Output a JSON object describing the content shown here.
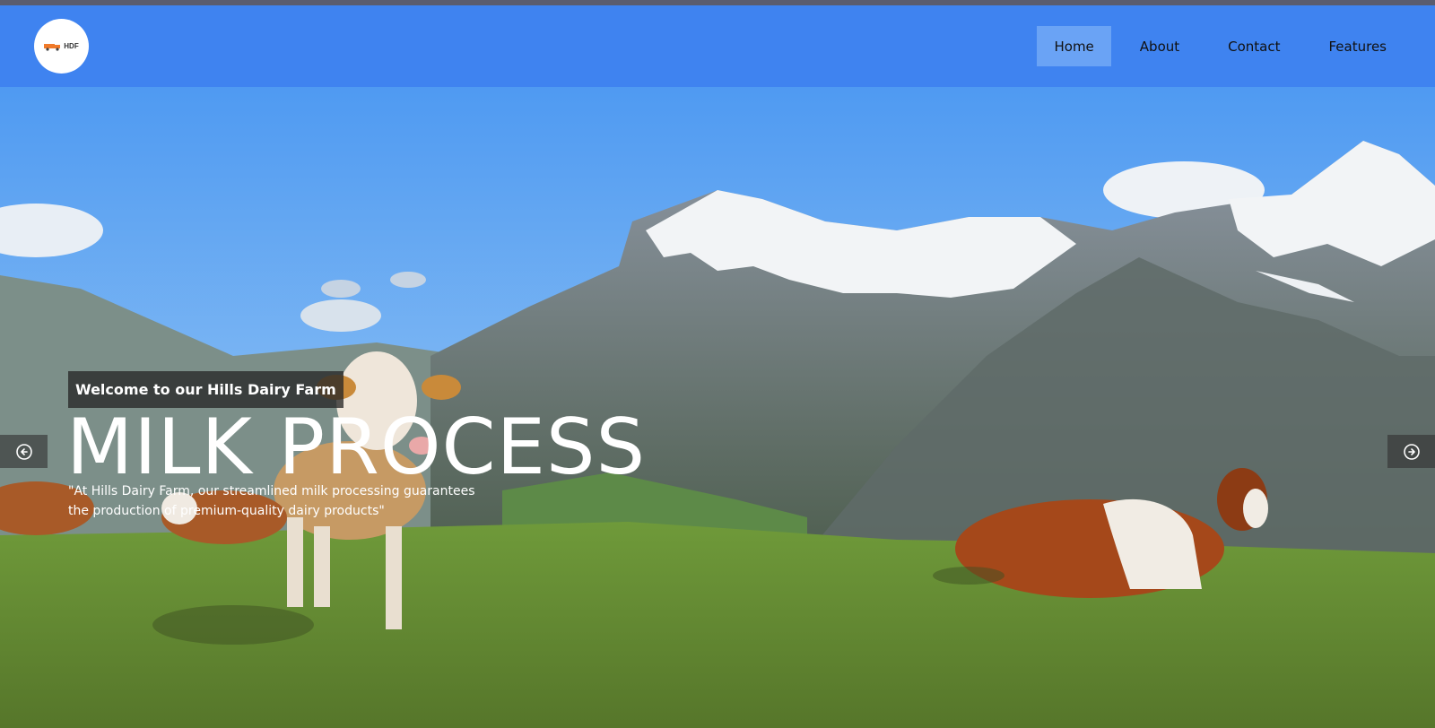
{
  "logo": {
    "text": "HDF",
    "icon": "truck-icon",
    "accent": "#f07a2a"
  },
  "nav": {
    "items": [
      {
        "label": "Home",
        "active": true
      },
      {
        "label": "About",
        "active": false
      },
      {
        "label": "Contact",
        "active": false
      },
      {
        "label": "Features",
        "active": false
      }
    ]
  },
  "hero": {
    "badge": "Welcome to our Hills Dairy Farm",
    "title": "MILK PROCESS",
    "description": "\"At Hills Dairy Farm, our streamlined milk processing guarantees the production of premium-quality dairy products\"",
    "prev_icon": "arrow-left-circle-icon",
    "next_icon": "arrow-right-circle-icon"
  },
  "colors": {
    "navbar": "#3f83f0",
    "nav_active": "#6aa3f5",
    "top_strip": "#5a5c6e"
  }
}
